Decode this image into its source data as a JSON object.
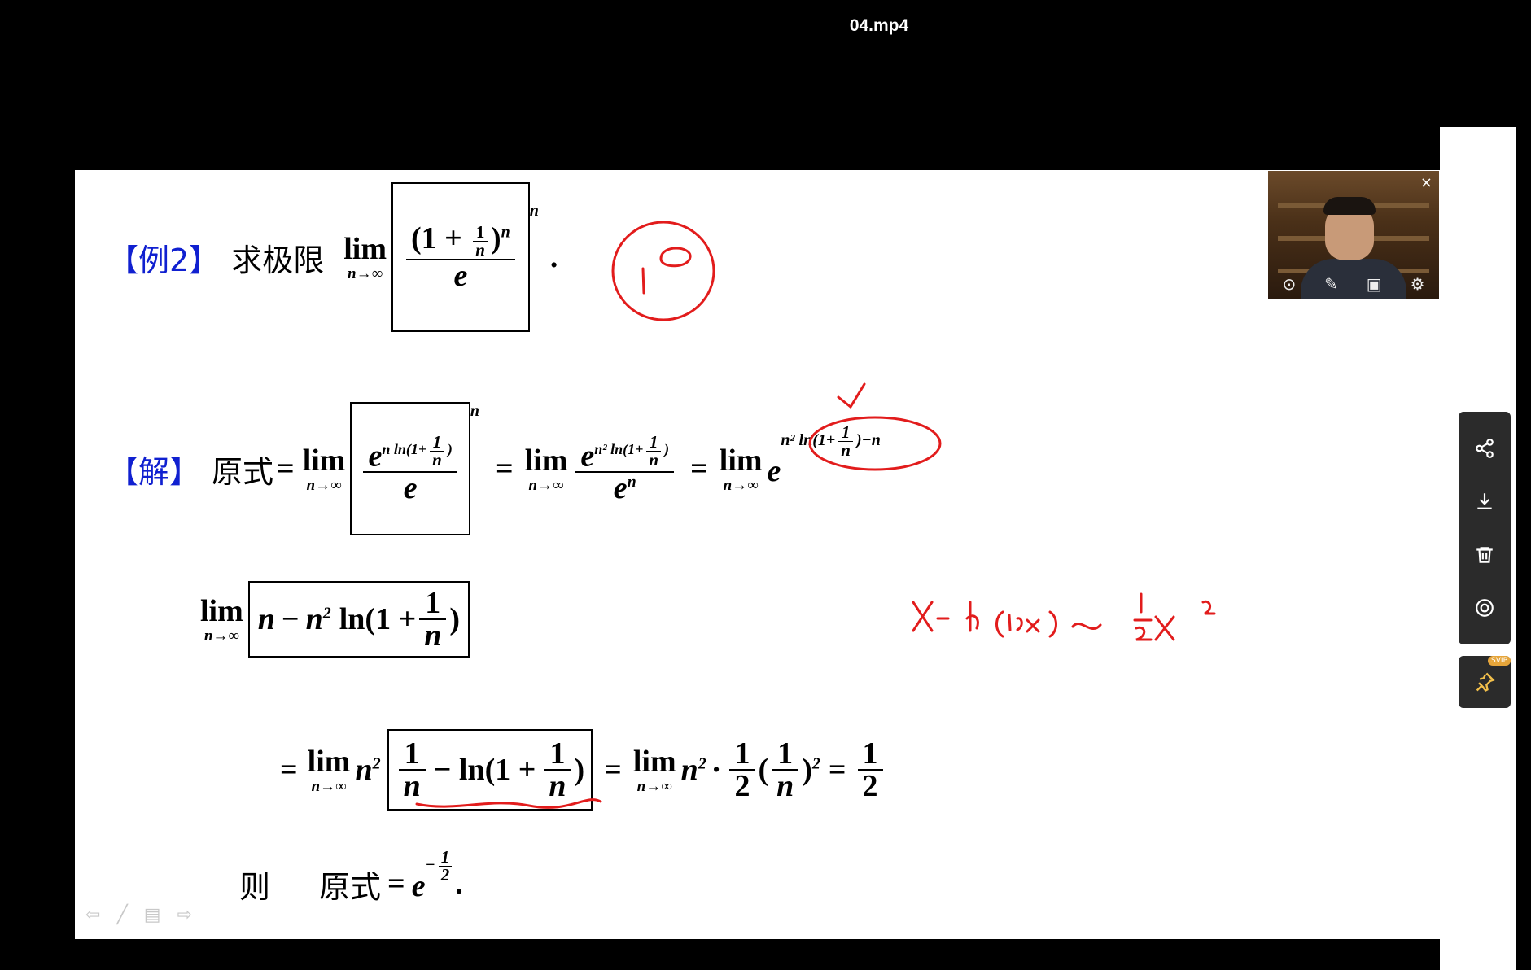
{
  "window": {
    "title": "04.mp4"
  },
  "slide": {
    "example_tag": "【例2】",
    "example_text": "求极限",
    "solution_tag": "【解】",
    "orig_expr": "原式",
    "then_text": "则",
    "lim_word": "lim",
    "lim_sub": "n→∞"
  },
  "annotations": {
    "one_inf": "1^∞",
    "equivalence": "x− ln(1+x) ~ ½x²",
    "check": "✓"
  },
  "webcam": {
    "close_symbol": "×"
  },
  "side_toolbar": {
    "items": [
      "share-icon",
      "download-icon",
      "delete-icon",
      "eye-icon"
    ],
    "pin_badge": "SVIP"
  },
  "nav": {
    "items": [
      "prev-arrow-icon",
      "pen-icon",
      "menu-icon",
      "next-arrow-icon"
    ]
  },
  "colors": {
    "accent_blue": "#1020d0",
    "ink_red": "#e21c1c",
    "progress": "#8de0c6"
  }
}
